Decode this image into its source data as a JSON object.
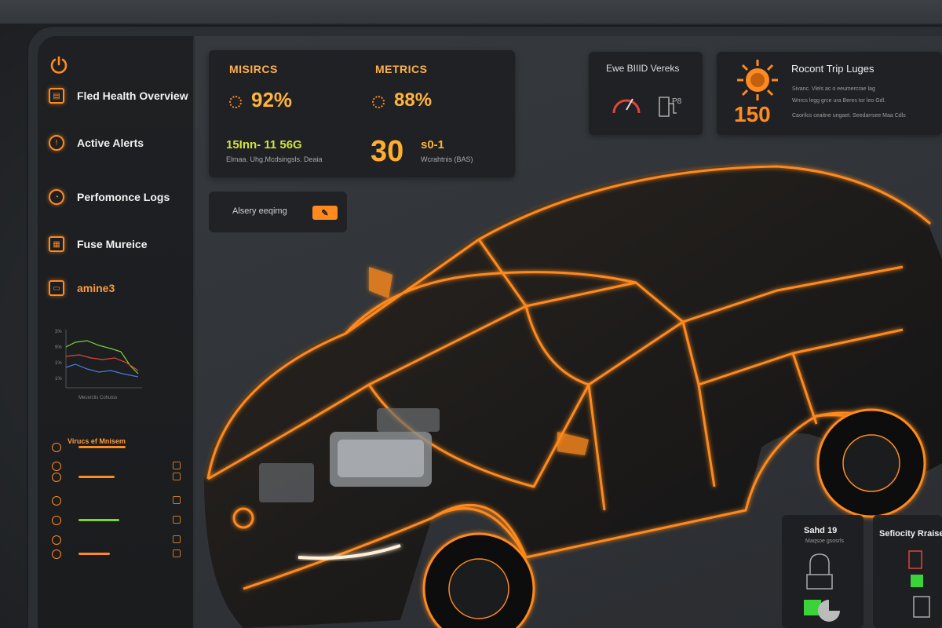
{
  "sidebar": {
    "items": [
      {
        "label": "Fled Health Overview",
        "icon": "document-icon"
      },
      {
        "label": "Active Alerts",
        "icon": "alert-icon"
      },
      {
        "label": "Perfomonce Logs",
        "icon": "gauge-icon"
      },
      {
        "label": "Fuse Mureice",
        "icon": "fuse-box-icon"
      },
      {
        "label": "amine3",
        "icon": "folder-icon"
      }
    ],
    "chart_caption": "Mecerclis Cohutos",
    "chart_ticks": [
      "3%",
      "9%",
      "1%",
      "1%"
    ],
    "list_title": "Virucs ef Mnisem"
  },
  "metrics": {
    "title_left": "MISIRCS",
    "title_right": "METRICS",
    "value_left": "92%",
    "value_right": "88%",
    "sub_value": "15Inn- 11 56G",
    "sub_label": "Elmaa. Uhg.Mcdsingsls. Deaia",
    "huge_value": "30",
    "huge_suffix": "s0-1",
    "huge_label": "Wcrahtnis (BAS)"
  },
  "search": {
    "text": "Alsery eeqimg"
  },
  "obd": {
    "title": "Ewe BIIID Vereks",
    "label": "P8"
  },
  "trip": {
    "title": "Rocont Trip Luges",
    "value": "150",
    "lines": [
      "Sivanc. Vlels ac o eeumercrae lag",
      "Wnrcs legg grce ura Beres tor leo Gdl.",
      "Caorilcs ceaitne ungaet. Seedarrsee Maa Cdls"
    ]
  },
  "bottom": {
    "left_title": "Sahd 19",
    "left_sub": "Maqsoe gsosrls",
    "right_title": "Sefiocity Rraise"
  },
  "colors": {
    "accent": "#ff8a1f",
    "accent_glow": "#ffb43a",
    "green": "#7ad43a"
  }
}
